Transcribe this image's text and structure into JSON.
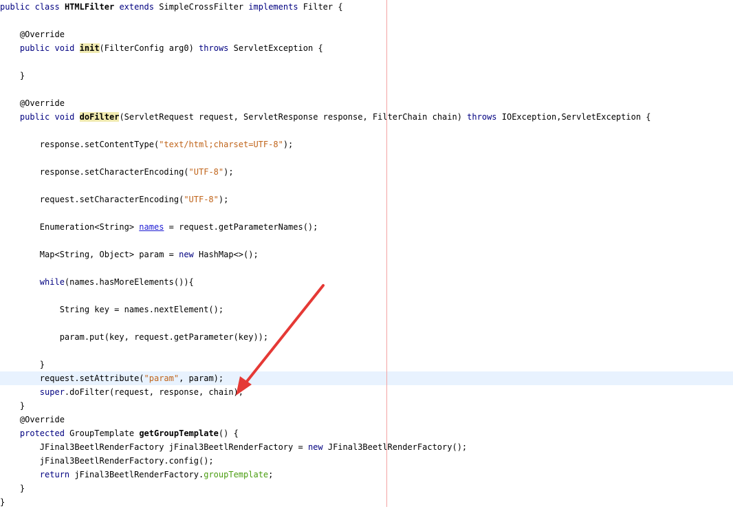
{
  "editor": {
    "current_line_index": 27,
    "colors": {
      "keyword": "#000080",
      "string": "#c0641a",
      "field": "#4a9d10",
      "link": "#1d1bd3",
      "symbol_highlight": "#f0eab0",
      "current_line": "#e8f2fe",
      "right_margin": "#f2a3a3",
      "arrow": "#e53935"
    },
    "lines": [
      {
        "tokens": [
          {
            "t": "public",
            "c": "kw"
          },
          {
            "t": " "
          },
          {
            "t": "class",
            "c": "kw"
          },
          {
            "t": " "
          },
          {
            "t": "HTMLFilter",
            "c": "bold"
          },
          {
            "t": " "
          },
          {
            "t": "extends",
            "c": "kw"
          },
          {
            "t": " SimpleCrossFilter "
          },
          {
            "t": "implements",
            "c": "kw"
          },
          {
            "t": " Filter {"
          }
        ]
      },
      {
        "tokens": []
      },
      {
        "tokens": [
          {
            "t": "    "
          },
          {
            "t": "@Override",
            "c": "annot"
          }
        ]
      },
      {
        "tokens": [
          {
            "t": "    "
          },
          {
            "t": "public",
            "c": "kw"
          },
          {
            "t": " "
          },
          {
            "t": "void",
            "c": "kw"
          },
          {
            "t": " "
          },
          {
            "t": "init",
            "c": "bold hl"
          },
          {
            "t": "(FilterConfig arg0) "
          },
          {
            "t": "throws",
            "c": "kw"
          },
          {
            "t": " ServletException {"
          }
        ]
      },
      {
        "tokens": []
      },
      {
        "tokens": [
          {
            "t": "    }"
          }
        ]
      },
      {
        "tokens": []
      },
      {
        "tokens": [
          {
            "t": "    "
          },
          {
            "t": "@Override",
            "c": "annot"
          }
        ]
      },
      {
        "tokens": [
          {
            "t": "    "
          },
          {
            "t": "public",
            "c": "kw"
          },
          {
            "t": " "
          },
          {
            "t": "void",
            "c": "kw"
          },
          {
            "t": " "
          },
          {
            "t": "doFilter",
            "c": "bold hl"
          },
          {
            "t": "(ServletRequest request, ServletResponse response, FilterChain chain) "
          },
          {
            "t": "throws",
            "c": "kw"
          },
          {
            "t": " IOException,ServletException {"
          }
        ]
      },
      {
        "tokens": []
      },
      {
        "tokens": [
          {
            "t": "        response.setContentType("
          },
          {
            "t": "\"text/html;charset=UTF-8\"",
            "c": "str"
          },
          {
            "t": ");"
          }
        ]
      },
      {
        "tokens": []
      },
      {
        "tokens": [
          {
            "t": "        response.setCharacterEncoding("
          },
          {
            "t": "\"UTF-8\"",
            "c": "str"
          },
          {
            "t": ");"
          }
        ]
      },
      {
        "tokens": []
      },
      {
        "tokens": [
          {
            "t": "        request.setCharacterEncoding("
          },
          {
            "t": "\"UTF-8\"",
            "c": "str"
          },
          {
            "t": ");"
          }
        ]
      },
      {
        "tokens": []
      },
      {
        "tokens": [
          {
            "t": "        Enumeration<String> "
          },
          {
            "t": "names",
            "c": "link"
          },
          {
            "t": " = request.getParameterNames();"
          }
        ]
      },
      {
        "tokens": []
      },
      {
        "tokens": [
          {
            "t": "        Map<String, Object> param = "
          },
          {
            "t": "new",
            "c": "kw"
          },
          {
            "t": " HashMap<>();"
          }
        ]
      },
      {
        "tokens": []
      },
      {
        "tokens": [
          {
            "t": "        "
          },
          {
            "t": "while",
            "c": "kw"
          },
          {
            "t": "(names.hasMoreElements()){"
          }
        ]
      },
      {
        "tokens": []
      },
      {
        "tokens": [
          {
            "t": "            String key = names.nextElement();"
          }
        ]
      },
      {
        "tokens": []
      },
      {
        "tokens": [
          {
            "t": "            param.put(key, request.getParameter(key));"
          }
        ]
      },
      {
        "tokens": []
      },
      {
        "tokens": [
          {
            "t": "        }"
          }
        ]
      },
      {
        "tokens": [
          {
            "t": "        request.setAttribute("
          },
          {
            "t": "\"param\"",
            "c": "str"
          },
          {
            "t": ", param);"
          }
        ]
      },
      {
        "tokens": [
          {
            "t": "        "
          },
          {
            "t": "super",
            "c": "kw"
          },
          {
            "t": ".doFilter(request, response, chain);"
          }
        ]
      },
      {
        "tokens": [
          {
            "t": "    }"
          }
        ]
      },
      {
        "tokens": [
          {
            "t": "    "
          },
          {
            "t": "@Override",
            "c": "annot"
          }
        ]
      },
      {
        "tokens": [
          {
            "t": "    "
          },
          {
            "t": "protected",
            "c": "kw"
          },
          {
            "t": " GroupTemplate "
          },
          {
            "t": "getGroupTemplate",
            "c": "bold"
          },
          {
            "t": "() {"
          }
        ]
      },
      {
        "tokens": [
          {
            "t": "        JFinal3BeetlRenderFactory jFinal3BeetlRenderFactory = "
          },
          {
            "t": "new",
            "c": "kw"
          },
          {
            "t": " JFinal3BeetlRenderFactory();"
          }
        ]
      },
      {
        "tokens": [
          {
            "t": "        jFinal3BeetlRenderFactory.config();"
          }
        ]
      },
      {
        "tokens": [
          {
            "t": "        "
          },
          {
            "t": "return",
            "c": "kw"
          },
          {
            "t": " jFinal3BeetlRenderFactory."
          },
          {
            "t": "groupTemplate",
            "c": "fld"
          },
          {
            "t": ";"
          }
        ]
      },
      {
        "tokens": [
          {
            "t": "    }"
          }
        ]
      },
      {
        "tokens": [
          {
            "t": "}"
          }
        ]
      }
    ]
  }
}
